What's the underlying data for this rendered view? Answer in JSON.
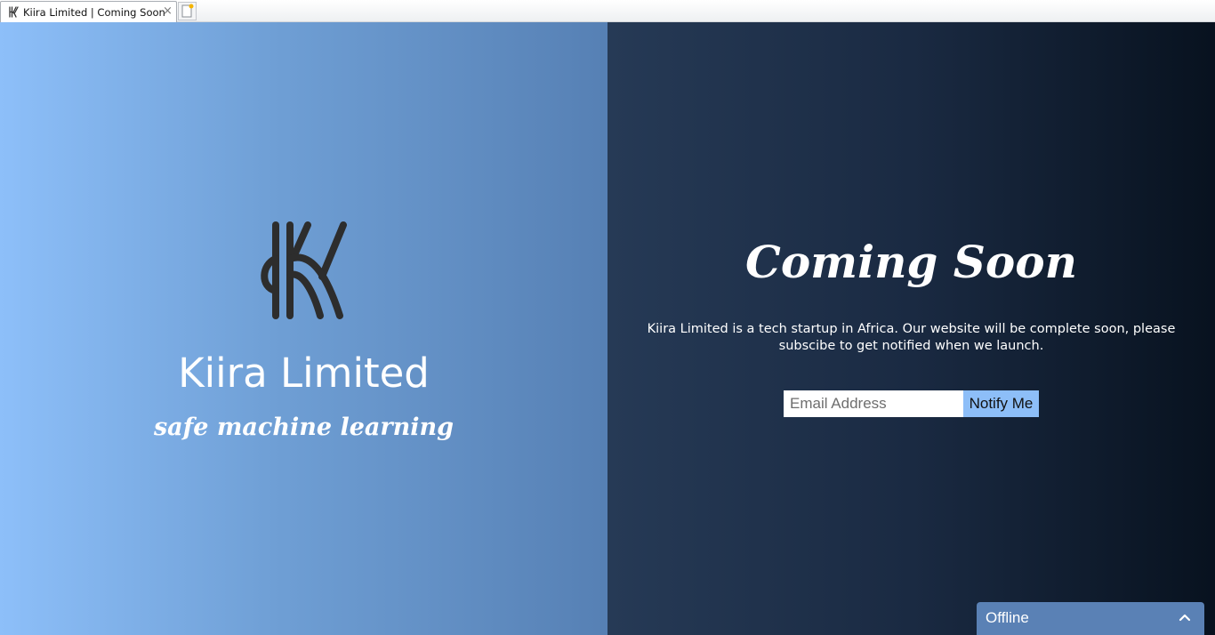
{
  "browser": {
    "tab_title": "Kiira Limited | Coming Soon",
    "close_glyph": "×",
    "favicon": "kiira-logo-icon",
    "new_tab_icon": "new-tab-icon"
  },
  "brand": {
    "logo_icon": "kiira-logo-icon",
    "name": "Kiira Limited",
    "tagline": "safe machine learning"
  },
  "main": {
    "heading": "Coming Soon",
    "description": "Kiira Limited is a tech startup in Africa. Our website will be complete soon, please subscibe to get notified when we launch.",
    "email_placeholder": "Email Address",
    "email_value": "",
    "notify_label": "Notify Me"
  },
  "chat": {
    "status": "Offline",
    "toggle_icon": "chevron-up-icon"
  },
  "colors": {
    "left_gradient_start": "#8dbff9",
    "left_gradient_end": "#5680b4",
    "right_gradient_start": "#263a56",
    "right_gradient_end": "#08121f",
    "button_bg": "#8dbef8",
    "chat_bg": "#5a81b5",
    "logo_color": "#2d2d2d"
  }
}
